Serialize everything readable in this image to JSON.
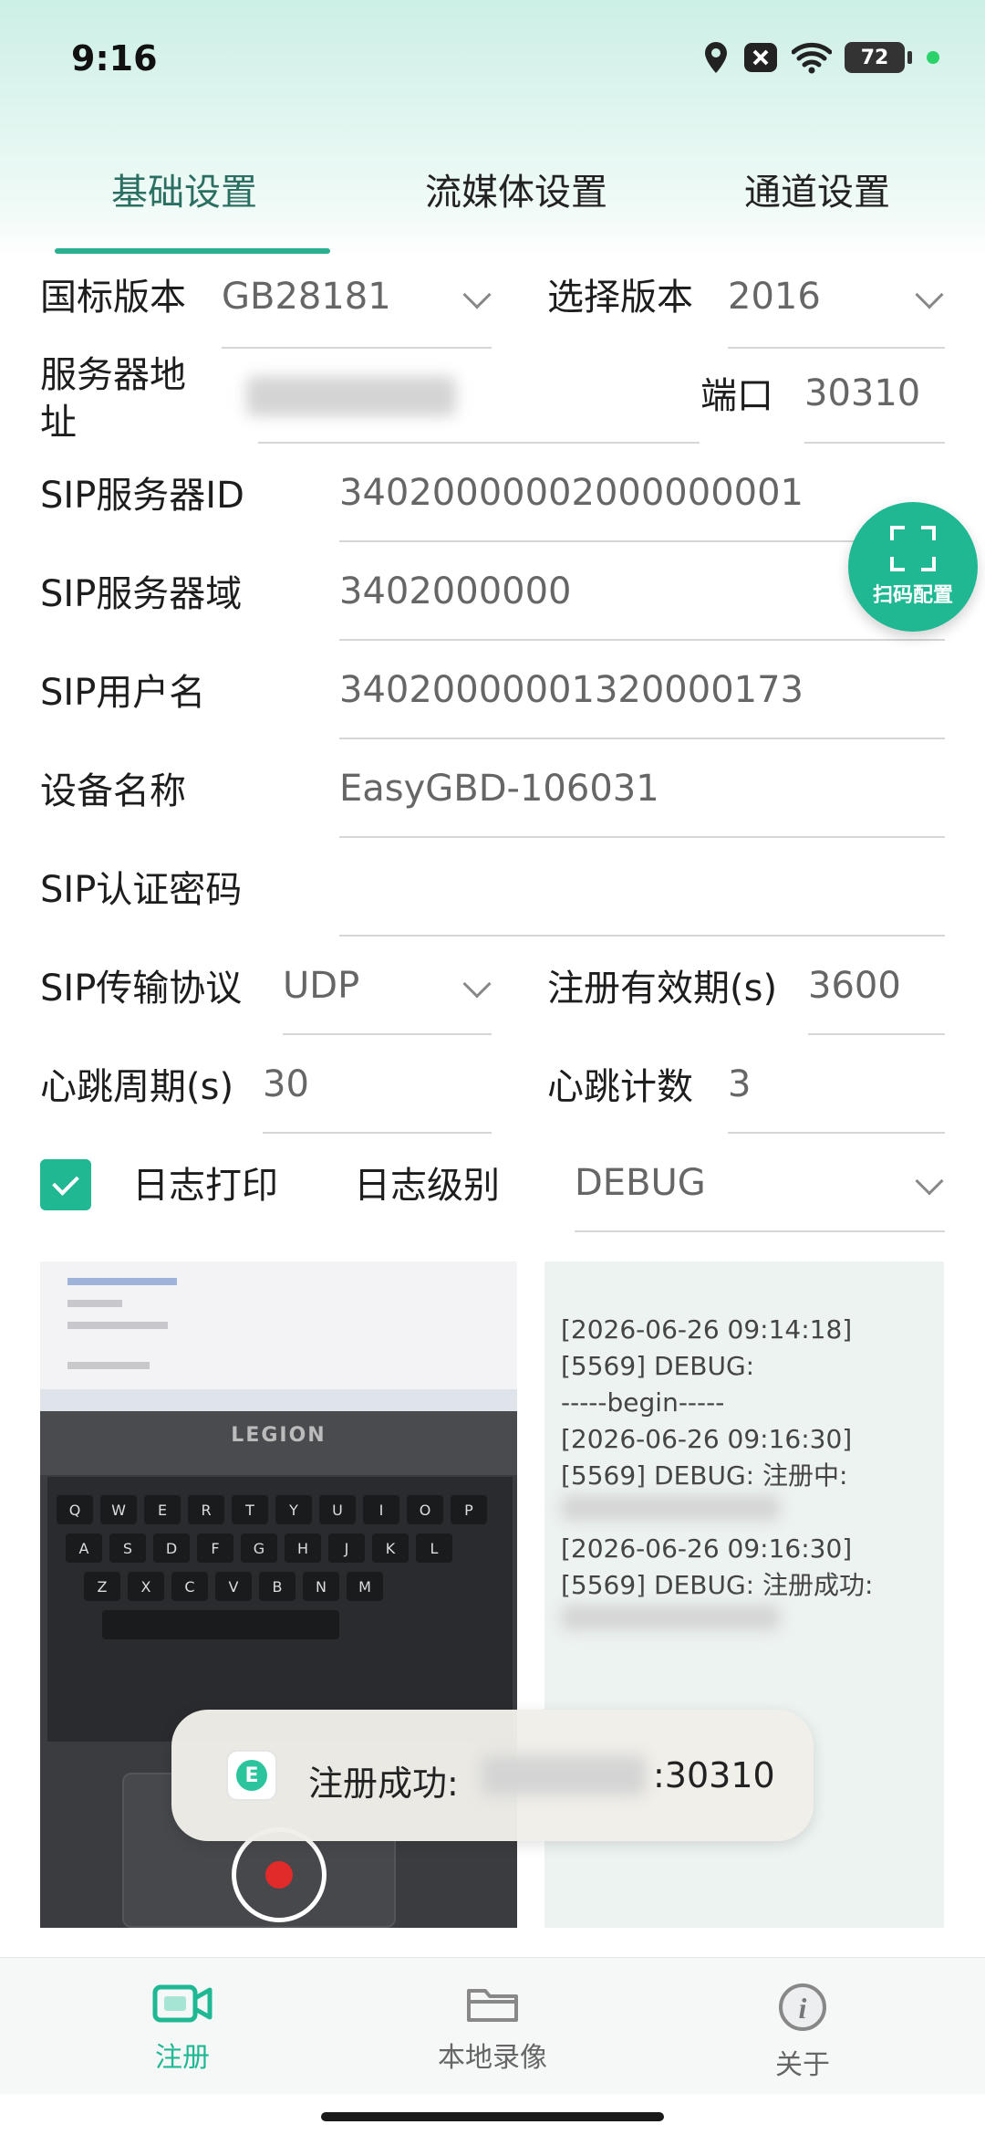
{
  "status": {
    "time": "9:16",
    "battery": "72"
  },
  "tabs": [
    {
      "label": "基础设置"
    },
    {
      "label": "流媒体设置"
    },
    {
      "label": "通道设置"
    }
  ],
  "form": {
    "gb_version_label": "国标版本",
    "gb_version_value": "GB28181",
    "select_version_label": "选择版本",
    "select_version_value": "2016",
    "server_addr_label_1": "服务器地",
    "server_addr_label_2": "址",
    "port_label": "端口",
    "port_value": "30310",
    "sip_server_id_label": "SIP服务器ID",
    "sip_server_id_value": "34020000002000000001",
    "sip_domain_label": "SIP服务器域",
    "sip_domain_value": "3402000000",
    "sip_user_label": "SIP用户名",
    "sip_user_value": "34020000001320000173",
    "device_name_label": "设备名称",
    "device_name_value": "EasyGBD-106031",
    "sip_password_label": "SIP认证密码",
    "sip_password_value": "",
    "sip_transport_label": "SIP传输协议",
    "sip_transport_value": "UDP",
    "reg_expiry_label": "注册有效期(s)",
    "reg_expiry_value": "3600",
    "heartbeat_period_label": "心跳周期(s)",
    "heartbeat_period_value": "30",
    "heartbeat_count_label": "心跳计数",
    "heartbeat_count_value": "3",
    "log_print_label": "日志打印",
    "log_level_label": "日志级别",
    "log_level_value": "DEBUG"
  },
  "scan_button": {
    "label": "扫码配置"
  },
  "log_lines": [
    "[2026-06-26 09:14:18]",
    "[5569] DEBUG:",
    "-----begin-----",
    "[2026-06-26 09:16:30]",
    "[5569] DEBUG: 注册中:",
    "",
    "[2026-06-26 09:16:30]",
    "[5569] DEBUG: 注册成功:"
  ],
  "toast": {
    "text": "注册成功:",
    "port": ":30310"
  },
  "preview": {
    "brand": "LEGION"
  },
  "bottom_nav": [
    {
      "label": "注册",
      "icon": "video-camera-icon"
    },
    {
      "label": "本地录像",
      "icon": "folder-icon"
    },
    {
      "label": "关于",
      "icon": "info-icon"
    }
  ],
  "colors": {
    "accent": "#1fb893",
    "tab_active": "#2a6f61"
  }
}
